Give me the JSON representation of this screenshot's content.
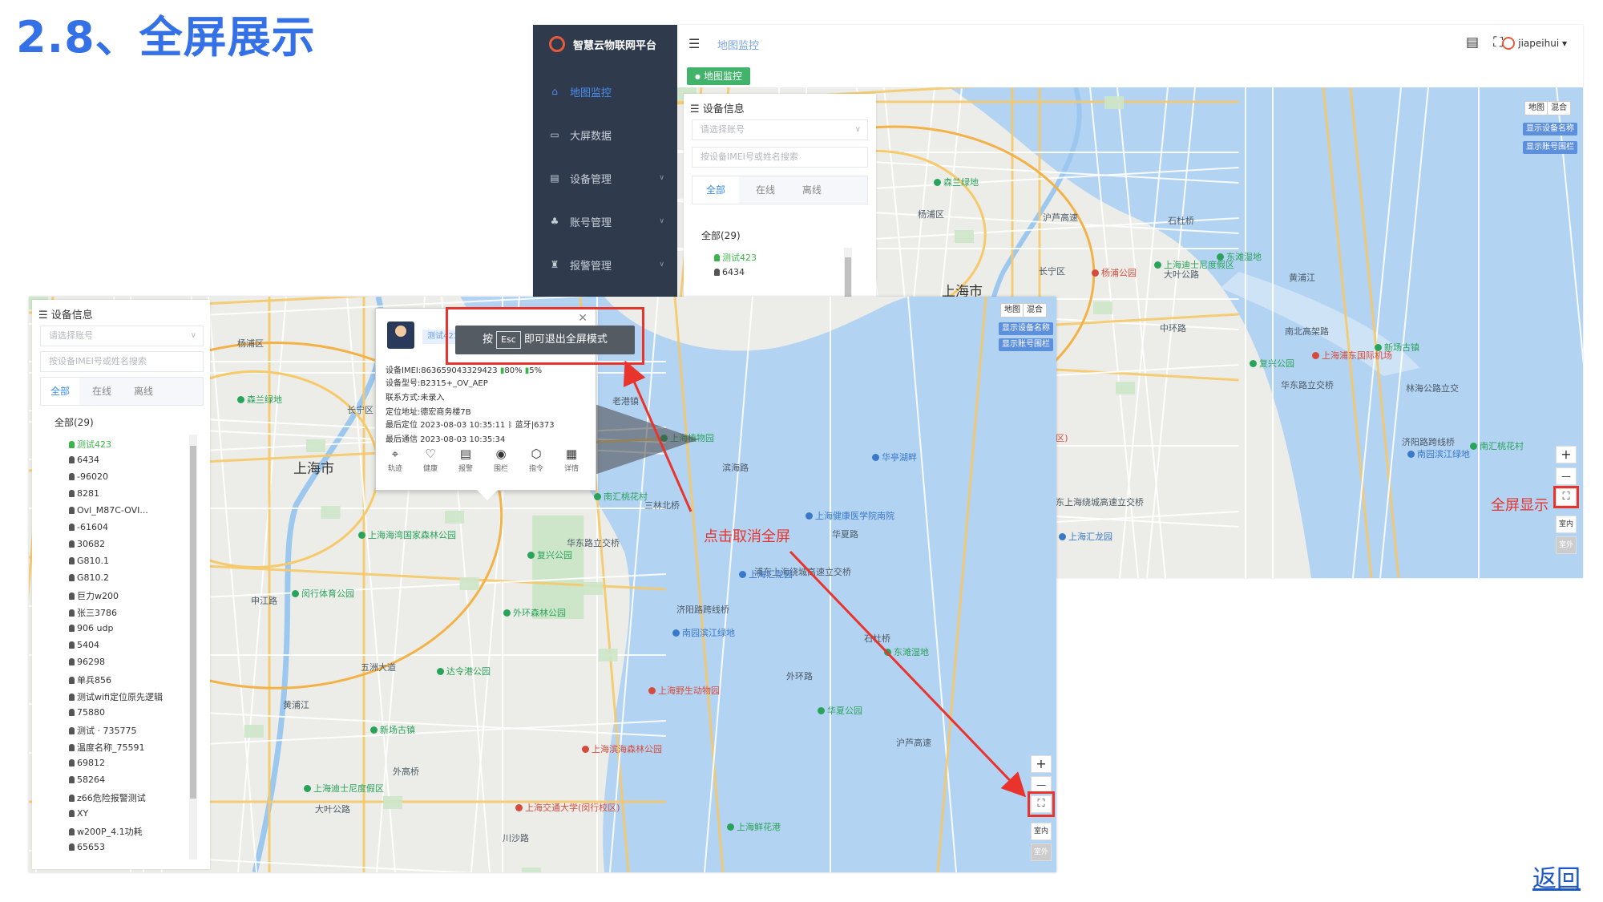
{
  "heading": "2.8、全屏展示",
  "back_link": "返回",
  "app": {
    "brand": "智慧云物联网平台",
    "breadcrumb": "地图监控",
    "user": "jiapeihui",
    "active_tag": "地图监控",
    "sidebar": [
      {
        "label": "地图监控",
        "icon": "home-icon",
        "active": true
      },
      {
        "label": "大屏数据",
        "icon": "chart-icon",
        "active": false
      },
      {
        "label": "设备管理",
        "icon": "device-icon",
        "active": false
      },
      {
        "label": "账号管理",
        "icon": "account-icon",
        "active": false
      },
      {
        "label": "报警管理",
        "icon": "alarm-icon",
        "active": false
      }
    ]
  },
  "panel": {
    "title": "设备信息",
    "account_placeholder": "请选择账号",
    "search_placeholder": "按设备IMEI号或姓名搜索",
    "tabs": [
      "全部",
      "在线",
      "离线"
    ],
    "total": "全部(29)",
    "devices": [
      "测试423",
      "6434",
      "-96020",
      "8281",
      "Ovl_M87C-OVI...",
      "-61604",
      "30682",
      "G810.1",
      "G810.2",
      "巨力w200",
      "张三3786",
      "906 udp",
      "5404",
      "96298",
      "单兵856",
      "测试wifi定位原先逻辑",
      "75880",
      "测试 · 735775",
      "温度名称_75591",
      "69812",
      "58264",
      "z66危险报警测试",
      "XY",
      "w200P_4.1功耗",
      "65653"
    ],
    "devices_short": [
      "测试423",
      "6434"
    ]
  },
  "map": {
    "type_buttons": [
      "地图",
      "混合"
    ],
    "toggles": [
      "显示设备名称",
      "显示账号围栏"
    ],
    "zoom_in": "+",
    "zoom_out": "—",
    "indoor": "室内",
    "indoor_off": "室外",
    "city": "上海市",
    "labels": [
      "杨浦区",
      "长宁区",
      "中环路",
      "华东路立交桥",
      "济阳路跨线桥",
      "外环路",
      "沪芦高速",
      "大叶公路",
      "南北高架路",
      "林海公路立交",
      "三林北桥",
      "浦东上海绕城高速立交桥",
      "石杜桥",
      "黄浦江",
      "外高桥",
      "川沙路",
      "老港镇",
      "滨海路",
      "华夏路",
      "申江路",
      "五洲大道"
    ],
    "pois": [
      "森兰绿地",
      "杨浦公园",
      "复兴公园",
      "南园滨江绿地",
      "华夏公园",
      "上海迪士尼度假区",
      "上海浦东国际机场",
      "南汇桃花村",
      "上海汇龙园",
      "东滩湿地",
      "新场古镇",
      "上海交通大学(闵行校区)",
      "上海植物园",
      "上海健康医学院南院",
      "闵行体育公园",
      "达令港公园",
      "上海滨海森林公园",
      "上海鲜花港",
      "华亭湖畔",
      "上海海湾国家森林公园",
      "外环森林公园",
      "上海野生动物园"
    ]
  },
  "popup": {
    "name": "测试423",
    "imei_line": "设备IMEI:863659043329423",
    "battery": "80%",
    "signal": "5%",
    "model_line": "设备型号:B2315+_OV_AEP",
    "contact_line": "联系方式:未录入",
    "address_line": "定位地址:德宏商务楼7B",
    "last_loc_line": "最后定位 2023-08-03 10:35:11",
    "bluetooth": "蓝牙|6373",
    "last_comm_line": "最后通信 2023-08-03 10:35:34",
    "actions": [
      "轨迹",
      "健康",
      "报警",
      "围栏",
      "指令",
      "详情"
    ]
  },
  "esc_tip": {
    "prefix": "按",
    "key": "Esc",
    "suffix": "即可退出全屏模式"
  },
  "annotations": {
    "cancel_fullscreen": "点击取消全屏",
    "show_fullscreen": "全屏显示"
  },
  "colors": {
    "accent": "#3a8ee6",
    "online": "#3bb54a",
    "annotation_red": "#e8342c",
    "sidebar": "#2f3b4d",
    "water": "#b3d3f3"
  }
}
